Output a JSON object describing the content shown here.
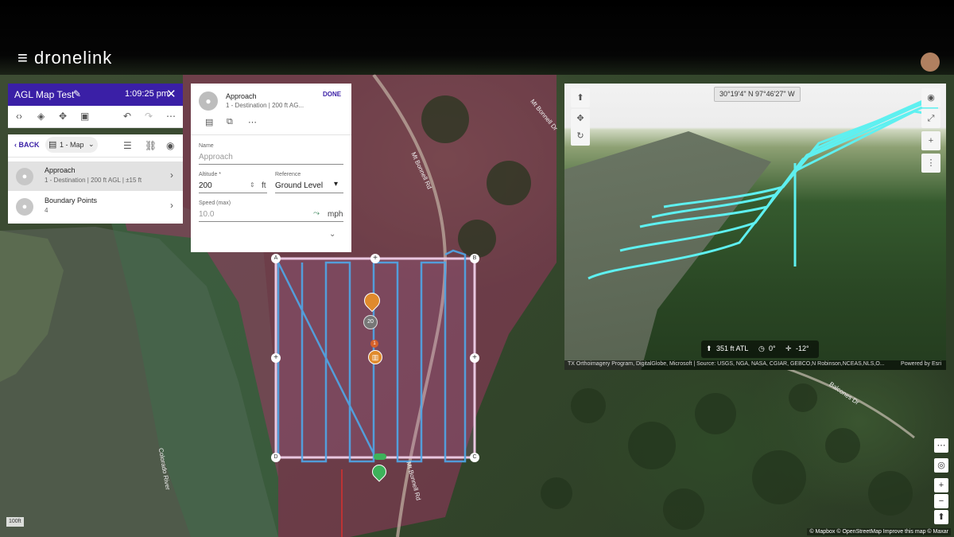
{
  "app": {
    "brand": "dronelink"
  },
  "mission": {
    "title": "AGL Map Test",
    "time": "1:09:25 pm"
  },
  "nav": {
    "back_label": "BACK",
    "map_select": "1 - Map"
  },
  "components": [
    {
      "name": "Approach",
      "detail": "1 - Destination | 200 ft AGL | ±15 ft"
    },
    {
      "name": "Boundary Points",
      "detail": "4"
    }
  ],
  "editor": {
    "title": "Approach",
    "subtitle": "1 - Destination | 200 ft AG...",
    "done_label": "DONE",
    "name_label": "Name",
    "name_value": "Approach",
    "altitude_label": "Altitude *",
    "altitude_value": "200",
    "altitude_unit": "ft",
    "reference_label": "Reference",
    "reference_value": "Ground Level",
    "speed_label": "Speed (max)",
    "speed_value": "10.0",
    "speed_unit": "mph"
  },
  "view3d": {
    "coordinates": "30°19'4\" N 97°46'27\" W",
    "altitude_readout": "351 ft ATL",
    "heading_readout": "0°",
    "pitch_readout": "-12°",
    "attribution": "TX Orthoimagery Program, DigitalGlobe, Microsoft | Source: USGS, NGA, NASA, CGIAR, GEBCO,N Robinson,NCEAS,NLS,O...",
    "powered_by": "Powered by Esri"
  },
  "map": {
    "corner_labels": [
      "A",
      "B",
      "C",
      "D"
    ],
    "waypoint_count_badge": "20",
    "marker_badge": "1",
    "scale_label": "100ft",
    "copyright": "© Mapbox © OpenStreetMap  Improve this map  © Maxar",
    "road_labels": [
      "Balcones Dr",
      "Mt Bonnell Rd",
      "Colorado River",
      "Mt Bonnell Dr"
    ]
  },
  "colors": {
    "accent": "#3a1fa6",
    "path": "#4fa6e8",
    "flight3d": "#5ef0f0",
    "boundary": "#e9c7e0"
  }
}
